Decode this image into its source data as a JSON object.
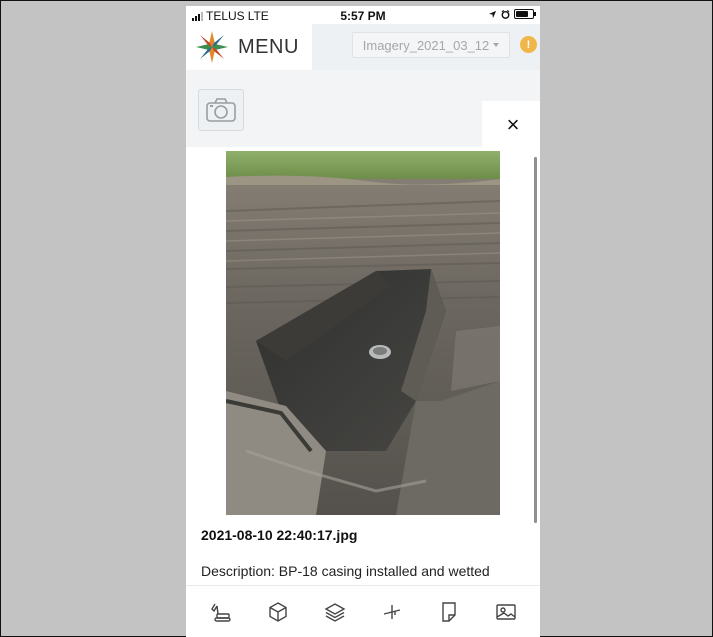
{
  "status_bar": {
    "carrier": "TELUS",
    "network": "LTE",
    "time": "5:57 PM"
  },
  "header": {
    "menu_label": "MENU",
    "imagery_selected": "Imagery_2021_03_12",
    "alert_badge": "!"
  },
  "modal": {
    "close_label": "×",
    "photo": {
      "file_name": "2021-08-10 22:40:17.jpg",
      "description": "Description: BP-18 casing installed and wetted"
    }
  },
  "toolbar": {
    "items": [
      {
        "icon": "excavator-icon"
      },
      {
        "icon": "cube-icon"
      },
      {
        "icon": "layers-icon"
      },
      {
        "icon": "measure-icon"
      },
      {
        "icon": "document-icon"
      },
      {
        "icon": "image-icon"
      }
    ]
  },
  "colors": {
    "background": "#c3c3c3",
    "app_surface": "#f2f4f6",
    "alert": "#f0b64a",
    "icon_stroke": "#444444"
  }
}
